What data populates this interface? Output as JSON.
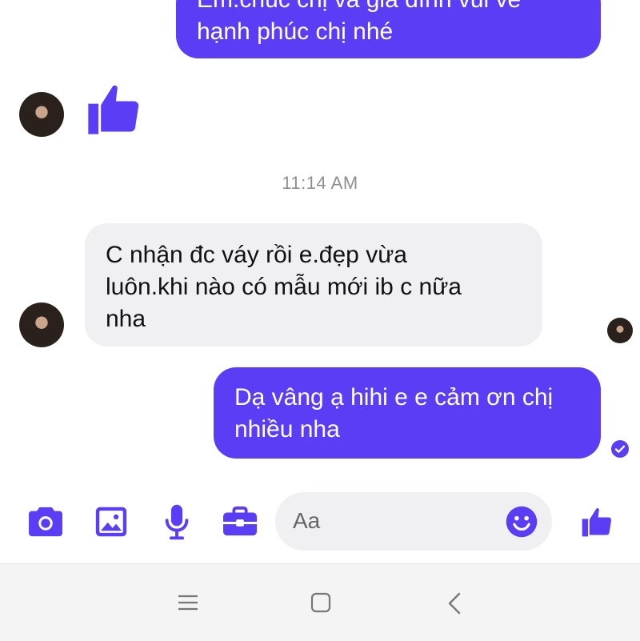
{
  "messages": {
    "top_outgoing": {
      "line1": "Em.chúc chị và gia đình vui vẻ",
      "line2": "hạnh phúc chị nhé"
    },
    "timestamp": "11:14 AM",
    "incoming": {
      "text_line1": "C nhận đc váy rồi e.đẹp vừa",
      "text_line2": "luôn.khi nào có mẫu mới ib c nữa",
      "text_line3": "nha"
    },
    "outgoing": {
      "text_line1": "Dạ vâng ạ hihi e e cảm ơn chị",
      "text_line2": "nhiều nha"
    }
  },
  "composer": {
    "placeholder": "Aa",
    "icons": [
      "camera-icon",
      "image-icon",
      "microphone-icon",
      "toolbox-icon",
      "emoji-icon",
      "thumbs-up-icon"
    ]
  },
  "navbar": {
    "icons": [
      "menu-icon",
      "home-icon",
      "back-icon"
    ]
  },
  "colors": {
    "accent": "#5b3df5",
    "incoming_bubble": "#f0f0f2",
    "timestamp": "#8e8e93"
  }
}
